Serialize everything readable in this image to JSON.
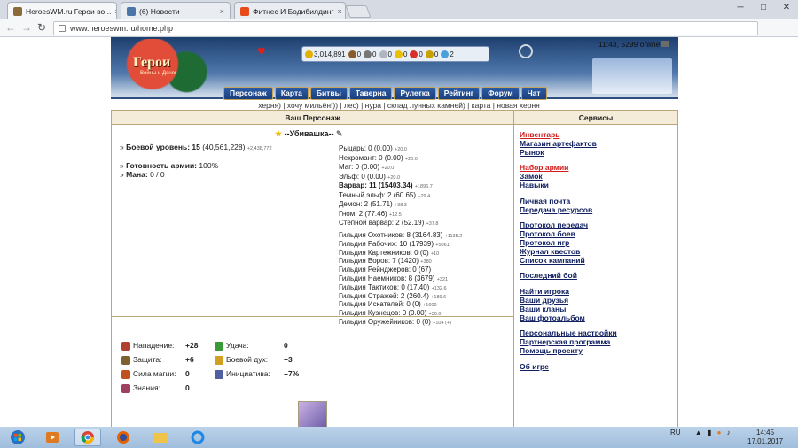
{
  "browser": {
    "tabs": [
      {
        "label": "HeroesWM.ru Герои во...",
        "active": true
      },
      {
        "label": "(6) Новости",
        "active": false
      },
      {
        "label": "Фитнес И Бодибилдинг",
        "active": false
      }
    ],
    "close_glyph": "×",
    "url": "www.heroeswm.ru/home.php",
    "ext_badge": "5"
  },
  "header": {
    "logo_text": "Герои",
    "logo_sub": "Войны и Денег",
    "online": "11:43, 5299 online",
    "resources": [
      {
        "icon": "gold-icon",
        "value": "3,014,891",
        "color": "#e0b100"
      },
      {
        "icon": "wood-icon",
        "value": "0",
        "color": "#8b5a2b"
      },
      {
        "icon": "ore-icon",
        "value": "0",
        "color": "#777777"
      },
      {
        "icon": "mercury-icon",
        "value": "0",
        "color": "#b0b6c0"
      },
      {
        "icon": "sulfur-icon",
        "value": "0",
        "color": "#e8c200"
      },
      {
        "icon": "crystal-icon",
        "value": "0",
        "color": "#d8302b"
      },
      {
        "icon": "gems-icon",
        "value": "0",
        "color": "#c8a000"
      },
      {
        "icon": "diamond-icon",
        "value": "2",
        "color": "#4aa0d8"
      }
    ],
    "nav": [
      "Персонаж",
      "Карта",
      "Битвы",
      "Таверна",
      "Рулетка",
      "Рейтинг",
      "Форум",
      "Чат"
    ],
    "subnav": "херня) | хочу мильён!)) | лес) | нура | склад лунных камней) | карта | новая херня"
  },
  "character": {
    "panel_title": "Ваш Персонаж",
    "name": "--Убивашка--",
    "level_label": "Боевой уровень:",
    "level": "15",
    "level_exp": "(40,561,228)",
    "level_add": "+2,438,772",
    "army_label": "Готовность армии:",
    "army": "100%",
    "mana_label": "Мана:",
    "mana": "0 / 0",
    "factions": [
      {
        "text": "Рыцарь: 0 (0.00)",
        "add": "+20.0",
        "bold": false
      },
      {
        "text": "Некромант: 0 (0.00)",
        "add": "+20.0",
        "bold": false
      },
      {
        "text": "Маг: 0 (0.00)",
        "add": "+20.0",
        "bold": false
      },
      {
        "text": "Эльф: 0 (0.00)",
        "add": "+20.0",
        "bold": false
      },
      {
        "text": "Варвар: 11 (15403.34)",
        "add": "+1896.7",
        "bold": true
      },
      {
        "text": "Темный эльф: 2 (60.65)",
        "add": "+29.4",
        "bold": false
      },
      {
        "text": "Демон: 2 (51.71)",
        "add": "+38.3",
        "bold": false
      },
      {
        "text": "Гном: 2 (77.46)",
        "add": "+12.5",
        "bold": false
      },
      {
        "text": "Степной варвар: 2 (52.19)",
        "add": "+37.8",
        "bold": false
      }
    ],
    "guilds": [
      {
        "text": "Гильдия Охотников: 8 (3164.83)",
        "add": "+1135.2"
      },
      {
        "text": "Гильдия Рабочих: 10 (17939)",
        "add": "+5061"
      },
      {
        "text": "Гильдия Картежников: 0 (0)",
        "add": "+10"
      },
      {
        "text": "Гильдия Воров: 7 (1420)",
        "add": "+380"
      },
      {
        "text": "Гильдия Рейнджеров: 0 (67)",
        "add": ""
      },
      {
        "text": "Гильдия Наемников: 8 (3679)",
        "add": "+321"
      },
      {
        "text": "Гильдия Тактиков: 0 (17.40)",
        "add": "+132.6"
      },
      {
        "text": "Гильдия Стражей: 2 (260.4)",
        "add": "+189.6"
      },
      {
        "text": "Гильдия Искателей: 0 (0)",
        "add": "+1600"
      },
      {
        "text": "Гильдия Кузнецов: 0 (0.00)",
        "add": "+30.0"
      },
      {
        "text": "Гильдия Оружейников: 0 (0)",
        "add": "+104 (+)"
      }
    ],
    "attributes": [
      {
        "icon": "attack-icon",
        "label": "Нападение:",
        "value": "+28",
        "color": "#b04030"
      },
      {
        "icon": "defense-icon",
        "label": "Защита:",
        "value": "+6",
        "color": "#806030"
      },
      {
        "icon": "magic-icon",
        "label": "Сила магии:",
        "value": "0",
        "color": "#c05020"
      },
      {
        "icon": "knowledge-icon",
        "label": "Знания:",
        "value": "0",
        "color": "#a04060"
      },
      {
        "icon": "luck-icon",
        "label": "Удача:",
        "value": "0",
        "color": "#3a9a3a"
      },
      {
        "icon": "morale-icon",
        "label": "Боевой дух:",
        "value": "+3",
        "color": "#d0a020"
      },
      {
        "icon": "initiative-icon",
        "label": "Инициатива:",
        "value": "+7%",
        "color": "#5060a0"
      }
    ]
  },
  "services": {
    "panel_title": "Сервисы",
    "items": [
      {
        "label": "Инвентарь",
        "red": true
      },
      {
        "label": "Магазин артефактов",
        "red": false
      },
      {
        "label": "Рынок",
        "red": false
      },
      {
        "label": "Набор армии",
        "red": true
      },
      {
        "label": "Замок",
        "red": false
      },
      {
        "label": "Навыки",
        "red": false
      },
      {
        "label": "Личная почта",
        "red": false
      },
      {
        "label": "Передача ресурсов",
        "red": false
      },
      {
        "label": "Протокол передач",
        "red": false
      },
      {
        "label": "Протокол боев",
        "red": false
      },
      {
        "label": "Протокол игр",
        "red": false
      },
      {
        "label": "Журнал квестов",
        "red": false
      },
      {
        "label": "Список кампаний",
        "red": false
      },
      {
        "label": "Последний бой",
        "red": false
      },
      {
        "label": "Найти игрока",
        "red": false
      },
      {
        "label": "Ваши друзья",
        "red": false
      },
      {
        "label": "Ваши кланы",
        "red": false
      },
      {
        "label": "Ваш фотоальбом",
        "red": false
      },
      {
        "label": "Персональные настройки",
        "red": false
      },
      {
        "label": "Партнерская программа",
        "red": false
      },
      {
        "label": "Помощь проекту",
        "red": false
      },
      {
        "label": "Об игре",
        "red": false
      }
    ]
  },
  "taskbar": {
    "lang": "RU",
    "time": "14:45",
    "date": "17.01.2017"
  }
}
